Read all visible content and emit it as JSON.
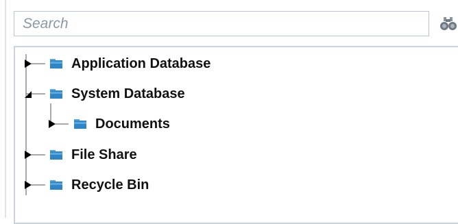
{
  "search": {
    "placeholder": "Search",
    "value": ""
  },
  "tree": {
    "nodes": [
      {
        "label": "Application Database",
        "state": "collapsed",
        "icon": "folder-icon"
      },
      {
        "label": "System Database",
        "state": "expanded",
        "icon": "folder-icon"
      },
      {
        "label": "Documents",
        "state": "collapsed",
        "icon": "folder-icon",
        "parent": "System Database"
      },
      {
        "label": "File Share",
        "state": "collapsed",
        "icon": "folder-icon"
      },
      {
        "label": "Recycle Bin",
        "state": "collapsed",
        "icon": "folder-icon"
      }
    ]
  },
  "colors": {
    "folder": "#2f86c6",
    "folder_tab": "#5aa7dc",
    "border": "#b9c6d6",
    "tree_line": "#555555"
  }
}
